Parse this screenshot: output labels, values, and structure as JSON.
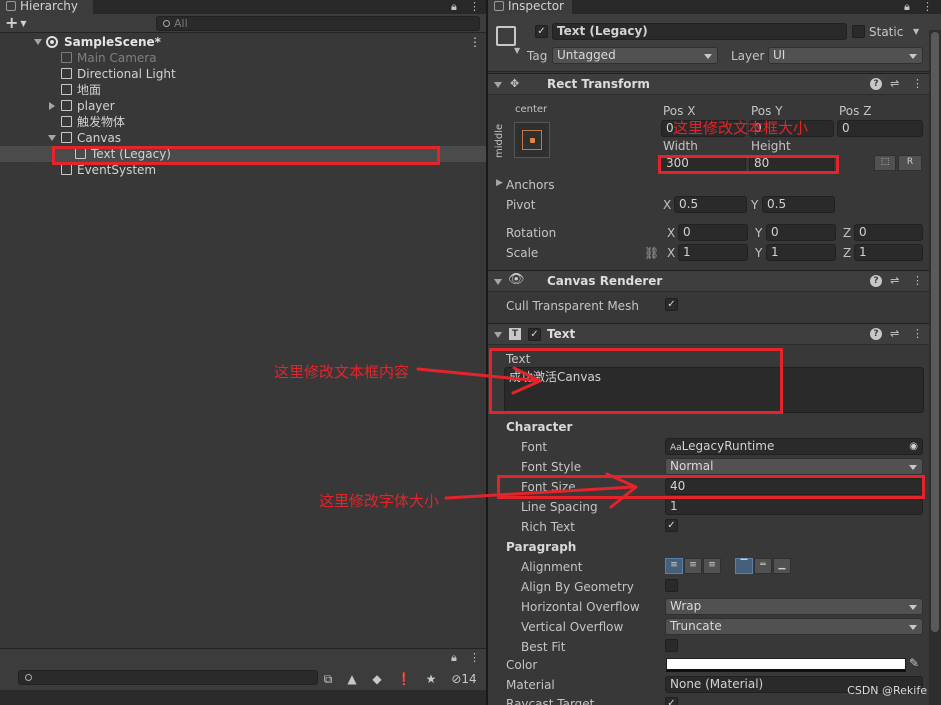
{
  "hierarchy": {
    "tab_title": "Hierarchy",
    "search_placeholder": "All",
    "add_symbol": "+",
    "items": [
      {
        "label": "SampleScene*",
        "level": 0,
        "expanded": true,
        "kind": "scene"
      },
      {
        "label": "Main Camera",
        "level": 1,
        "kind": "object",
        "dim": true
      },
      {
        "label": "Directional Light",
        "level": 1,
        "kind": "object"
      },
      {
        "label": "地面",
        "level": 1,
        "kind": "object"
      },
      {
        "label": "player",
        "level": 1,
        "kind": "object",
        "collapsed": true
      },
      {
        "label": "触发物体",
        "level": 1,
        "kind": "object"
      },
      {
        "label": "Canvas",
        "level": 1,
        "kind": "object",
        "expanded": true
      },
      {
        "label": "Text (Legacy)",
        "level": 2,
        "kind": "object",
        "selected": true
      },
      {
        "label": "EventSystem",
        "level": 1,
        "kind": "object"
      }
    ],
    "hidden_count": "14"
  },
  "inspector": {
    "tab_title": "Inspector",
    "object_name": "Text (Legacy)",
    "static_label": "Static",
    "tag_label": "Tag",
    "tag_value": "Untagged",
    "layer_label": "Layer",
    "layer_value": "UI",
    "rect_transform": {
      "title": "Rect Transform",
      "anchor_h": "center",
      "anchor_v": "middle",
      "pos_x_label": "Pos X",
      "pos_x": "0",
      "pos_y_label": "Pos Y",
      "pos_y": "0",
      "pos_z_label": "Pos Z",
      "pos_z": "0",
      "width_label": "Width",
      "width": "300",
      "height_label": "Height",
      "height": "80",
      "r_button": "R",
      "anchors_label": "Anchors",
      "pivot_label": "Pivot",
      "pivot_x": "0.5",
      "pivot_y": "0.5",
      "rotation_label": "Rotation",
      "rot_x": "0",
      "rot_y": "0",
      "rot_z": "0",
      "scale_label": "Scale",
      "scale_x": "1",
      "scale_y": "1",
      "scale_z": "1",
      "x": "X",
      "y": "Y",
      "z": "Z"
    },
    "canvas_renderer": {
      "title": "Canvas Renderer",
      "cull_label": "Cull Transparent Mesh"
    },
    "text": {
      "title": "Text",
      "text_label": "Text",
      "text_value": "成功激活Canvas",
      "character_label": "Character",
      "font_label": "Font",
      "font_value": "LegacyRuntime",
      "font_style_label": "Font Style",
      "font_style_value": "Normal",
      "font_size_label": "Font Size",
      "font_size_value": "40",
      "line_spacing_label": "Line Spacing",
      "line_spacing_value": "1",
      "rich_text_label": "Rich Text",
      "paragraph_label": "Paragraph",
      "alignment_label": "Alignment",
      "align_geometry_label": "Align By Geometry",
      "h_overflow_label": "Horizontal Overflow",
      "h_overflow_value": "Wrap",
      "v_overflow_label": "Vertical Overflow",
      "v_overflow_value": "Truncate",
      "best_fit_label": "Best Fit",
      "color_label": "Color",
      "material_label": "Material",
      "material_value": "None (Material)",
      "raycast_label": "Raycast Target"
    }
  },
  "annotations": {
    "size_note": "这里修改文本框大小",
    "content_note": "这里修改文本框内容",
    "font_size_note": "这里修改字体大小",
    "color": "#e3242b"
  },
  "watermark": "CSDN @Rekife"
}
